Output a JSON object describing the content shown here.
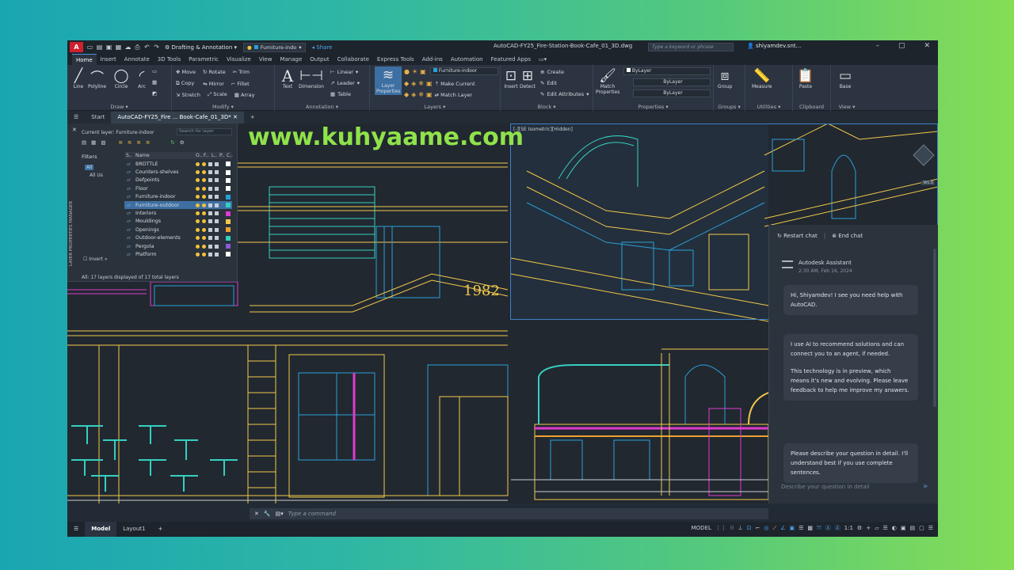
{
  "title_bar": {
    "logo": "A",
    "workspace": "Drafting & Annotation",
    "layer_current": "Furniture-indo",
    "share": "Share",
    "document": "AutoCAD-FY25_Fire-Station-Book-Cafe_01_3D.dwg",
    "search_placeholder": "Type a keyword or phrase",
    "user": "shiyamdev.snt..."
  },
  "menu_tabs": [
    "Home",
    "Insert",
    "Annotate",
    "3D Tools",
    "Parametric",
    "Visualize",
    "View",
    "Manage",
    "Output",
    "Collaborate",
    "Express Tools",
    "Add-ins",
    "Automation",
    "Featured Apps"
  ],
  "ribbon": {
    "draw": {
      "title": "Draw",
      "tools": [
        "Line",
        "Polyline",
        "Circle",
        "Arc"
      ]
    },
    "modify": {
      "title": "Modify",
      "rows": [
        [
          "Move",
          "Rotate",
          "Trim"
        ],
        [
          "Copy",
          "Mirror",
          "Fillet"
        ],
        [
          "Stretch",
          "Scale",
          "Array"
        ]
      ]
    },
    "annotation": {
      "title": "Annotation",
      "text": "Text",
      "dimension": "Dimension",
      "items": [
        "Linear",
        "Leader",
        "Table"
      ]
    },
    "layers": {
      "title": "Layers",
      "layer_properties": "Layer Properties",
      "dropdown": "Furniture-indoor",
      "items": [
        "Make Current",
        "Match Layer"
      ]
    },
    "block": {
      "title": "Block",
      "insert": "Insert",
      "detect": "Detect",
      "items": [
        "Create",
        "Edit",
        "Edit Attributes"
      ]
    },
    "properties": {
      "title": "Properties",
      "match": "Match Properties",
      "values": [
        "ByLayer",
        "ByLayer",
        "ByLayer"
      ]
    },
    "groups": {
      "title": "Groups",
      "label": "Group"
    },
    "utilities": {
      "title": "Utilities",
      "label": "Measure"
    },
    "clipboard": {
      "title": "Clipboard",
      "label": "Paste"
    },
    "view": {
      "title": "View",
      "label": "Base"
    }
  },
  "file_tabs": [
    "Start",
    "AutoCAD-FY25_Fire ... Book-Cafe_01_3D*"
  ],
  "layer_palette": {
    "current_layer": "Current layer: Furniture-indoor",
    "search_placeholder": "Search for layer",
    "filters_label": "Filters",
    "tree": [
      "All",
      "All Us"
    ],
    "columns": [
      "S..",
      "Name",
      "O..",
      "F..",
      "L..",
      "P..",
      "C.."
    ],
    "layers": [
      {
        "name": "BRDTTLE",
        "color": "#ffffff"
      },
      {
        "name": "Counters-shelves",
        "color": "#ffffff"
      },
      {
        "name": "Defpoints",
        "color": "#ffffff"
      },
      {
        "name": "Floor",
        "color": "#ffffff"
      },
      {
        "name": "Furniture-indoor",
        "color": "#2aa0d8"
      },
      {
        "name": "Furniture-outdoor",
        "color": "#35d0c0"
      },
      {
        "name": "Interiors",
        "color": "#e03ad0"
      },
      {
        "name": "Mouldings",
        "color": "#f2c84b"
      },
      {
        "name": "Openings",
        "color": "#f0a030"
      },
      {
        "name": "Outdoor-elements",
        "color": "#35d0c0"
      },
      {
        "name": "Pergola",
        "color": "#8a5ad8"
      },
      {
        "name": "Platform",
        "color": "#ffffff"
      }
    ],
    "selected_index": 5,
    "invert": "Invert",
    "status": "All: 17 layers displayed of 17 total layers",
    "vertical_title": "LAYER PROPERTIES MANAGER"
  },
  "watermark": "www.kuhyaame.com",
  "drawing_year": "1982",
  "viewport_label": "[-][SE Isometric][Hidden]",
  "wcs": "WCS",
  "assistant": {
    "restart": "Restart chat",
    "end": "End chat",
    "name": "Autodesk Assistant",
    "time": "2:30 AM, Feb 16, 2024",
    "messages": [
      "Hi, Shiyamdev! I see you need help with AutoCAD.",
      "I use AI to recommend solutions and can connect you to an agent, if needed.",
      "This technology is in preview, which means it's new and evolving. Please leave feedback to help me improve my answers.",
      "Please describe your question in detail. I'll understand best if you use complete sentences."
    ],
    "input_placeholder": "Describe your question in detail"
  },
  "command_line": {
    "placeholder": "Type a command"
  },
  "status_bar": {
    "tabs": [
      "Model",
      "Layout1"
    ],
    "model_label": "MODEL",
    "scale": "1:1"
  }
}
